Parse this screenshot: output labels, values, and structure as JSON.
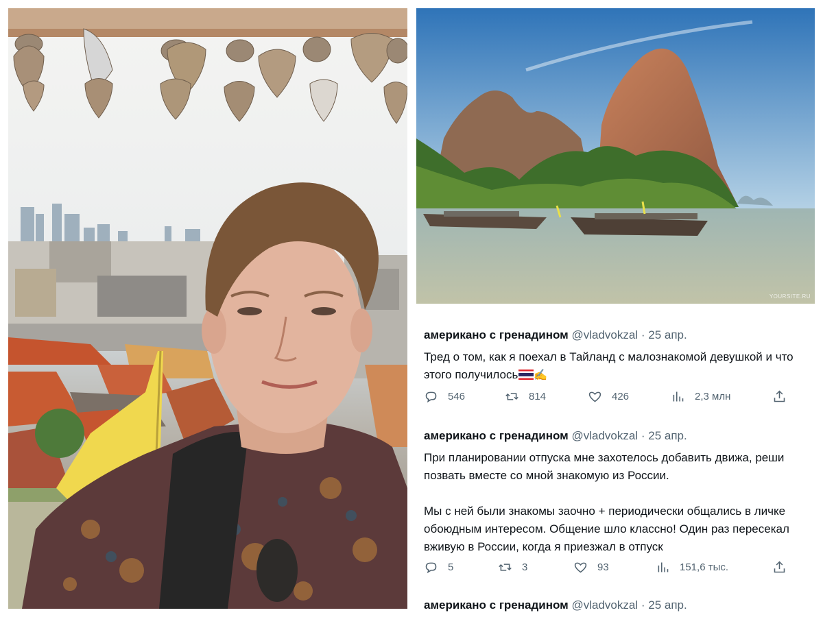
{
  "landscape": {
    "watermark": "YOURSITE.RU"
  },
  "tweets": [
    {
      "author_name": "американо с гренадином",
      "handle": "@vladvokzal",
      "separator": "·",
      "date": "25 апр.",
      "lines": [
        "Тред о том, как я поехал в Тайланд с малознакомой девушкой и что",
        "этого получилось"
      ],
      "emoji": [
        "thai-flag",
        "writing-hand"
      ],
      "stats": {
        "replies": "546",
        "retweets": "814",
        "likes": "426",
        "views": "2,3 млн"
      }
    },
    {
      "author_name": "американо с гренадином",
      "handle": "@vladvokzal",
      "separator": "·",
      "date": "25 апр.",
      "lines": [
        "При планировании отпуска мне захотелось добавить движа, реши",
        "позвать вместе со мной знакомую из России.",
        "",
        "Мы с ней были знакомы заочно + периодически общались в личке",
        "обоюдным интересом. Общение шло классно! Один раз пересекал",
        "вживую в России, когда я приезжал в отпуск"
      ],
      "stats": {
        "replies": "5",
        "retweets": "3",
        "likes": "93",
        "views": "151,6 тыс."
      }
    },
    {
      "author_name": "американо с гренадином",
      "handle": "@vladvokzal",
      "separator": "·",
      "date": "25 апр."
    }
  ],
  "icons": {
    "reply": "speech-bubble-icon",
    "retweet": "retweet-arrows-icon",
    "like": "heart-icon",
    "views": "bar-chart-icon",
    "share": "share-upload-icon"
  },
  "colors": {
    "text_primary": "#0f1419",
    "text_secondary": "#536471",
    "sky": "#3a7fc2",
    "sea": "#8fa79a"
  }
}
